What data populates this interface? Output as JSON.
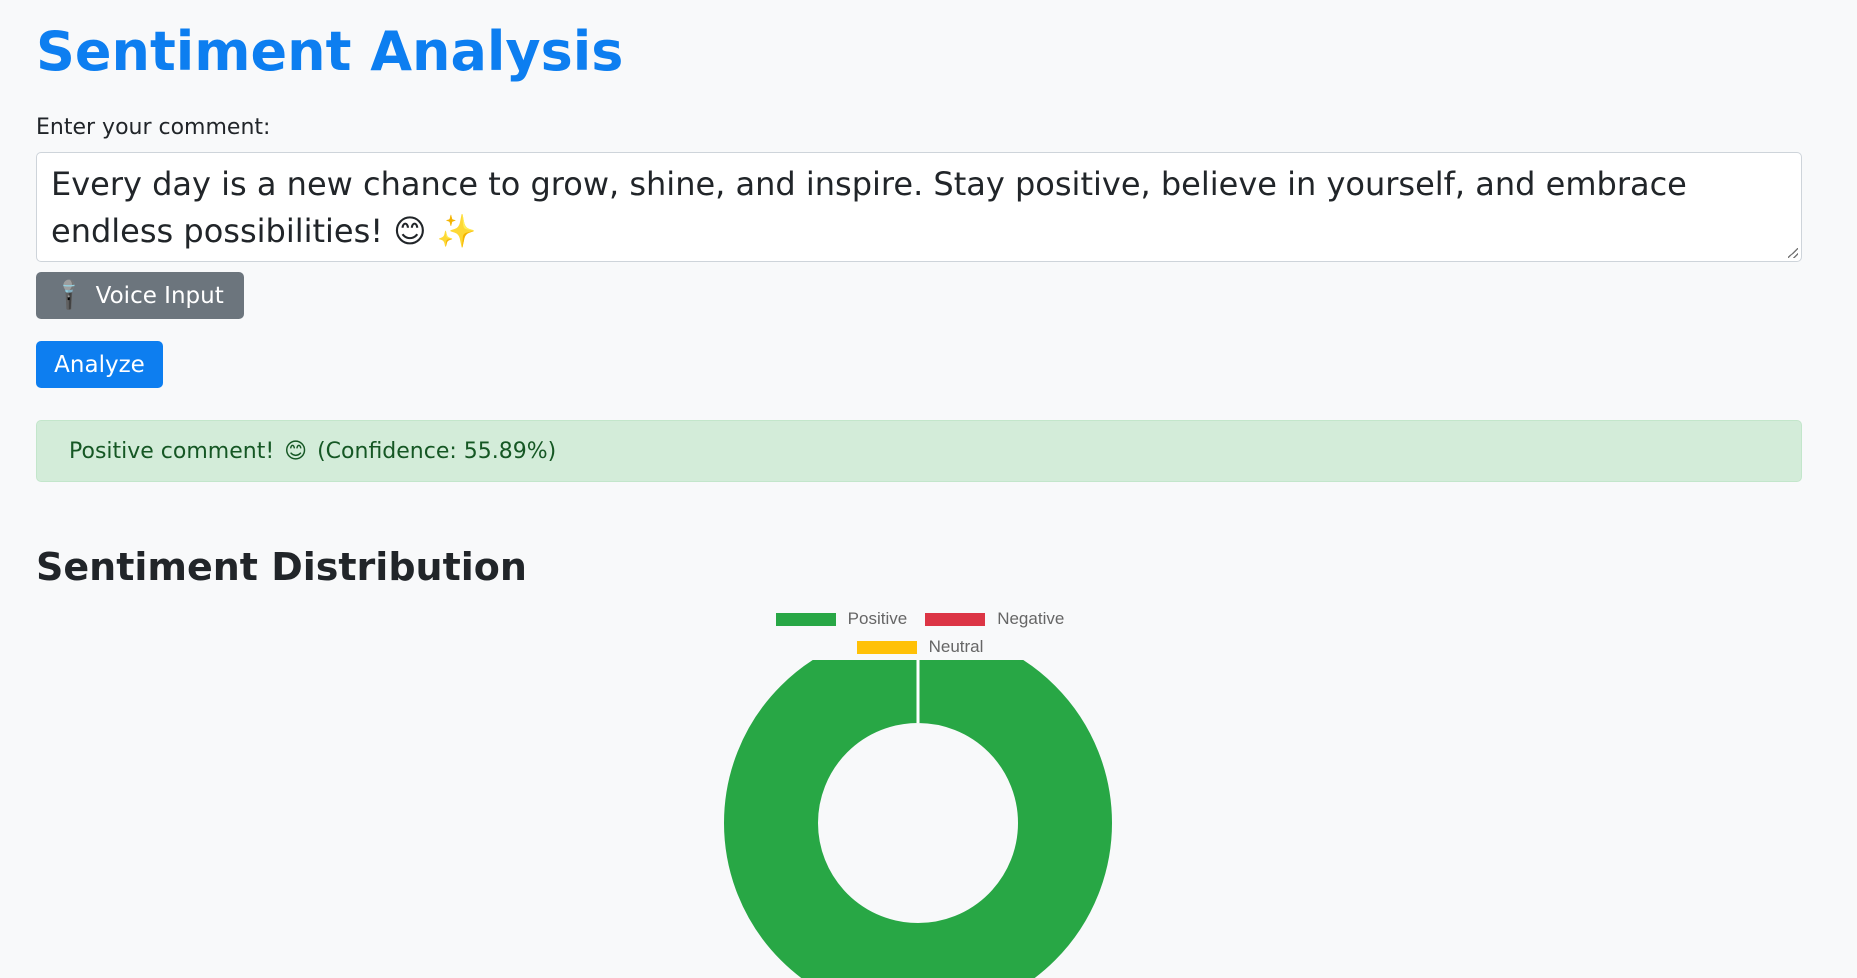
{
  "page": {
    "title": "Sentiment Analysis"
  },
  "comment": {
    "label": "Enter your comment:",
    "value": "Every day is a new chance to grow, shine, and inspire. Stay positive, believe in yourself, and embrace endless possibilities! 😊 ✨"
  },
  "buttons": {
    "voice_icon": "🎤",
    "voice_label": "Voice Input",
    "analyze_label": "Analyze"
  },
  "result": {
    "label": "Positive comment!",
    "emoji": "😊",
    "confidence_text": "(Confidence: 55.89%)"
  },
  "distribution": {
    "title": "Sentiment Distribution"
  },
  "chart_data": {
    "type": "pie",
    "variant": "doughnut",
    "legend_position": "top",
    "categories": [
      "Positive",
      "Negative",
      "Neutral"
    ],
    "values": [
      1,
      0,
      0
    ],
    "colors": [
      "#28a745",
      "#dc3545",
      "#ffc107"
    ]
  }
}
